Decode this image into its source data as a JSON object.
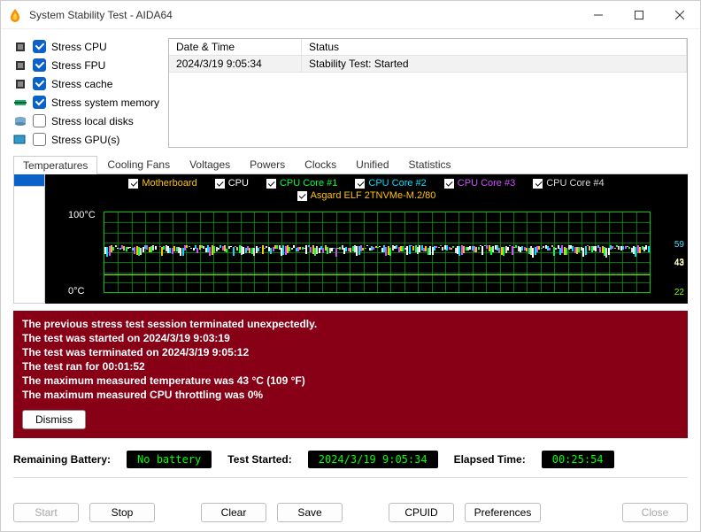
{
  "window": {
    "title": "System Stability Test - AIDA64"
  },
  "stress": {
    "items": [
      {
        "label": "Stress CPU",
        "checked": true
      },
      {
        "label": "Stress FPU",
        "checked": true
      },
      {
        "label": "Stress cache",
        "checked": true
      },
      {
        "label": "Stress system memory",
        "checked": true
      },
      {
        "label": "Stress local disks",
        "checked": false
      },
      {
        "label": "Stress GPU(s)",
        "checked": false
      }
    ]
  },
  "log": {
    "headers": {
      "datetime": "Date & Time",
      "status": "Status"
    },
    "rows": [
      {
        "datetime": "2024/3/19 9:05:34",
        "status": "Stability Test: Started"
      }
    ]
  },
  "tabs": [
    {
      "label": "Temperatures",
      "active": true
    },
    {
      "label": "Cooling Fans",
      "active": false
    },
    {
      "label": "Voltages",
      "active": false
    },
    {
      "label": "Powers",
      "active": false
    },
    {
      "label": "Clocks",
      "active": false
    },
    {
      "label": "Unified",
      "active": false
    },
    {
      "label": "Statistics",
      "active": false
    }
  ],
  "chart_data": {
    "type": "line",
    "title": "",
    "ylabel_top": "100°C",
    "ylabel_bottom": "0°C",
    "ylim": [
      0,
      100
    ],
    "right_labels": [
      {
        "value": "59",
        "color": "#46e0ff",
        "offset": 0
      },
      {
        "value": "43",
        "color": "#ffff66",
        "offset": 6
      },
      {
        "value": "43",
        "color": "#ffffff",
        "offset": 6.5
      },
      {
        "value": "22",
        "color": "#80ff00",
        "offset": 20
      }
    ],
    "series": [
      {
        "name": "Motherboard",
        "color": "#ffc300",
        "approx_value": 22
      },
      {
        "name": "CPU",
        "color": "#ffffff",
        "approx_value": 43
      },
      {
        "name": "CPU Core #1",
        "color": "#00ff40",
        "approx_value": 43
      },
      {
        "name": "CPU Core #2",
        "color": "#00e0ff",
        "approx_value": 59
      },
      {
        "name": "CPU Core #3",
        "color": "#d050ff",
        "approx_value": 43
      },
      {
        "name": "CPU Core #4",
        "color": "#d8d8d8",
        "approx_value": 43
      },
      {
        "name": "Asgard ELF 2TNVMe-M.2/80",
        "color": "#ffc300",
        "approx_value": 43
      }
    ]
  },
  "warning": {
    "lines": [
      "The previous stress test session terminated unexpectedly.",
      "The test was started on 2024/3/19 9:03:19",
      "The test was terminated on 2024/3/19 9:05:12",
      "The test ran for 00:01:52",
      "The maximum measured temperature was 43 °C  (109 °F)",
      "The maximum measured CPU throttling was 0%"
    ],
    "dismiss": "Dismiss"
  },
  "status": {
    "battery_label": "Remaining Battery:",
    "battery_value": "No battery",
    "started_label": "Test Started:",
    "started_value": "2024/3/19 9:05:34",
    "elapsed_label": "Elapsed Time:",
    "elapsed_value": "00:25:54"
  },
  "buttons": {
    "start": "Start",
    "stop": "Stop",
    "clear": "Clear",
    "save": "Save",
    "cpuid": "CPUID",
    "preferences": "Preferences",
    "close": "Close"
  }
}
